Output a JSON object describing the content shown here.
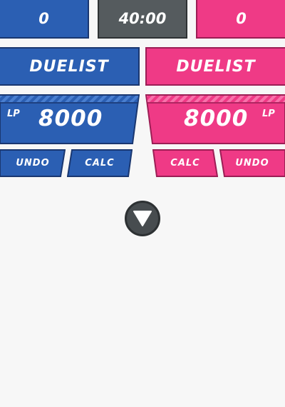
{
  "scoreboard": {
    "blue_score": "0",
    "timer": "40:00",
    "pink_score": "0"
  },
  "players": {
    "blue": {
      "name": "DUELIST",
      "lp_label": "LP",
      "lp_value": "8000",
      "undo_label": "UNDO",
      "calc_label": "CALC"
    },
    "pink": {
      "name": "DUELIST",
      "lp_label": "LP",
      "lp_value": "8000",
      "undo_label": "UNDO",
      "calc_label": "CALC"
    }
  },
  "toggle_icon": "triangle-down-icon",
  "colors": {
    "blue": "#2b5fb3",
    "blue_dark": "#1a3770",
    "pink": "#ef3a86",
    "pink_dark": "#9c1e55",
    "timer_gray": "#555b5e",
    "background": "#f7f7f7"
  }
}
